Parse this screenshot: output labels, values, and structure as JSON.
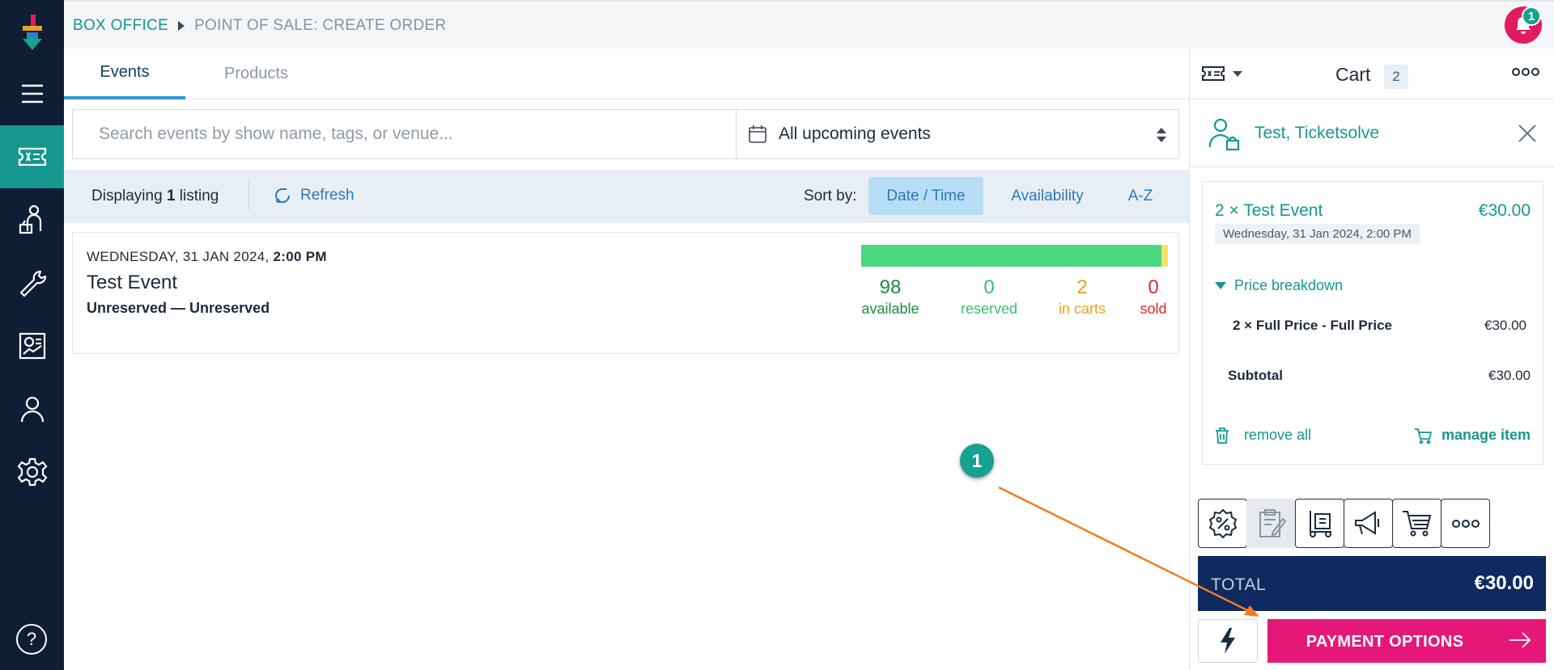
{
  "breadcrumb": {
    "section": "BOX OFFICE",
    "page": "POINT OF SALE: CREATE ORDER"
  },
  "notifications": {
    "count": "1"
  },
  "tabs": [
    {
      "label": "Events"
    },
    {
      "label": "Products"
    }
  ],
  "search": {
    "placeholder": "Search events by show name, tags, or venue...",
    "value": ""
  },
  "filter": {
    "selected": "All upcoming events"
  },
  "listing": {
    "prefix": "Displaying",
    "count": "1",
    "suffix": "listing",
    "refresh": "Refresh",
    "sort_label": "Sort by:",
    "sort_options": [
      "Date / Time",
      "Availability",
      "A-Z"
    ],
    "sort_selected": "Date / Time"
  },
  "event": {
    "date": "WEDNESDAY, 31 JAN 2024,",
    "time": "2:00 PM",
    "name": "Test Event",
    "seating": "Unreserved — Unreserved",
    "stats": [
      {
        "value": "98",
        "label": "available",
        "color": "#1f8a3d"
      },
      {
        "value": "0",
        "label": "reserved",
        "color": "#3bbf6b"
      },
      {
        "value": "2",
        "label": "in carts",
        "color": "#f0a020"
      },
      {
        "value": "0",
        "label": "sold",
        "color": "#d92b2b"
      }
    ],
    "capacity_fraction_available": 0.98,
    "capacity_fraction_in_carts": 0.02
  },
  "cart": {
    "title": "Cart",
    "count": "2",
    "customer": "Test, Ticketsolve",
    "item": {
      "title": "2 × Test Event",
      "price": "€30.00",
      "date": "Wednesday, 31 Jan 2024, 2:00 PM",
      "breakdown_label": "Price breakdown",
      "breakdown_line": "2 × Full Price - Full Price",
      "breakdown_amount": "€30.00",
      "subtotal_label": "Subtotal",
      "subtotal_amount": "€30.00",
      "remove_all": "remove all",
      "manage_item": "manage item"
    },
    "actions": [
      "discount-icon",
      "notes-icon",
      "delivery-icon",
      "marketing-icon",
      "basket-icon",
      "more-icon"
    ],
    "total_label": "TOTAL",
    "total_value": "€30.00",
    "pay_label": "PAYMENT OPTIONS"
  },
  "annotation": {
    "step": "1"
  },
  "colors": {
    "accent": "#15978f",
    "sidebar": "#0f1d35",
    "pay": "#e5187a",
    "total": "#0f2a5e",
    "annotation_arrow": "#f07d1e"
  }
}
